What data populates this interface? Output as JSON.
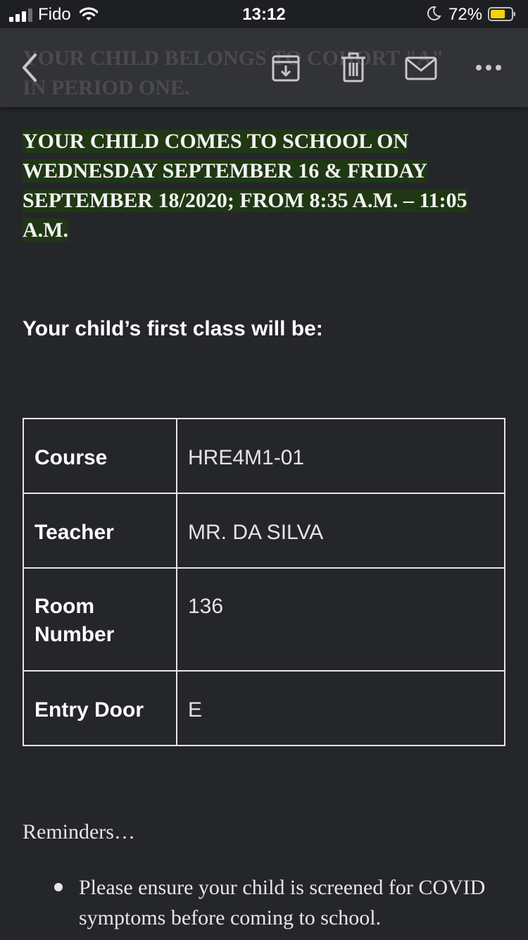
{
  "status_bar": {
    "carrier": "Fido",
    "time": "13:12",
    "battery_percent": "72%",
    "battery_level": 0.72,
    "signal_bars_active": 3,
    "signal_bars_total": 4
  },
  "toolbar": {
    "ghost_subject": "YOUR CHILD BELONGS TO COHORT \"A\"\nIN PERIOD ONE.",
    "icons": [
      "back-icon",
      "archive-icon",
      "trash-icon",
      "mail-icon",
      "more-icon"
    ]
  },
  "email": {
    "notice": "YOUR CHILD COMES TO SCHOOL ON WEDNESDAY SEPTEMBER 16 & FRIDAY SEPTEMBER 18/2020; FROM 8:35 A.M. – 11:05 A.M.",
    "notice_highlight_color": "#1f3713",
    "first_class_heading": "Your child’s first class will be:",
    "table": [
      {
        "label": "Course",
        "value": "HRE4M1-01"
      },
      {
        "label": "Teacher",
        "value": "MR.  DA SILVA"
      },
      {
        "label": "Room Number",
        "value": "136"
      },
      {
        "label": "Entry Door",
        "value": "E"
      }
    ],
    "reminders_heading": "Reminders…",
    "reminders": [
      "Please ensure your child is screened for COVID symptoms before coming to school."
    ]
  },
  "colors": {
    "background": "#25262a",
    "toolbar": "#323337",
    "battery_fill": "#f5d20c"
  }
}
